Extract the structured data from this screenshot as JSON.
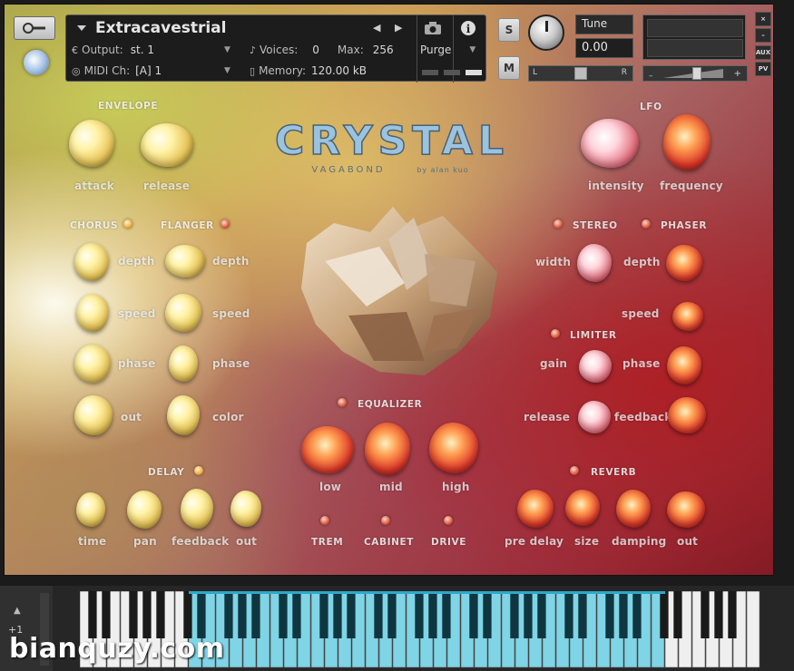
{
  "header": {
    "instrument_name": "Extracavestrial",
    "output_label": "Output:",
    "output_value": "st. 1",
    "voices_label": "Voices:",
    "voices_value": "0",
    "max_label": "Max:",
    "max_value": "256",
    "purge_label": "Purge",
    "midi_label": "MIDI Ch:",
    "midi_value": "[A]  1",
    "memory_label": "Memory:",
    "memory_value": "120.00 kB",
    "solo_label": "S",
    "mute_label": "M",
    "tune_label": "Tune",
    "tune_value": "0.00",
    "pan_left": "L",
    "pan_right": "R",
    "aux_label": "AUX",
    "pv_label": "PV",
    "close_label": "×",
    "minimize_label": "–"
  },
  "sections": {
    "envelope": "ENVELOPE",
    "lfo": "LFO",
    "chorus": "CHORUS",
    "flanger": "FLANGER",
    "stereo": "STEREO",
    "phaser": "PHASER",
    "limiter": "LIMITER",
    "delay": "DELAY",
    "equalizer": "EQUALIZER",
    "reverb": "REVERB"
  },
  "labels": {
    "attack": "attack",
    "release": "release",
    "intensity": "intensity",
    "frequency": "frequency",
    "chorus_depth": "depth",
    "chorus_speed": "speed",
    "chorus_phase": "phase",
    "chorus_out": "out",
    "flanger_depth": "depth",
    "flanger_speed": "speed",
    "flanger_phase": "phase",
    "flanger_color": "color",
    "stereo_width": "width",
    "phaser_depth": "depth",
    "phaser_speed": "speed",
    "limiter_gain": "gain",
    "limiter_phase": "phase",
    "limiter_release": "release",
    "limiter_feedback": "feedback",
    "delay_time": "time",
    "delay_pan": "pan",
    "delay_feedback": "feedback",
    "delay_out": "out",
    "eq_low": "low",
    "eq_mid": "mid",
    "eq_high": "high",
    "trem": "TREM",
    "cabinet": "CABINET",
    "drive": "DRIVE",
    "reverb_pre_delay": "pre delay",
    "reverb_size": "size",
    "reverb_damping": "damping",
    "reverb_out": "out"
  },
  "logo": {
    "text": "CRYSTAL",
    "sub": "VAGABOND",
    "by": "by alan kuo"
  },
  "keyboard": {
    "octave_label": "+1",
    "watermark": "bianquzy.com"
  },
  "colors": {
    "key_highlight": "#7fd4e6",
    "white_key": "#efefef",
    "black_key": "#1a1a1a"
  }
}
